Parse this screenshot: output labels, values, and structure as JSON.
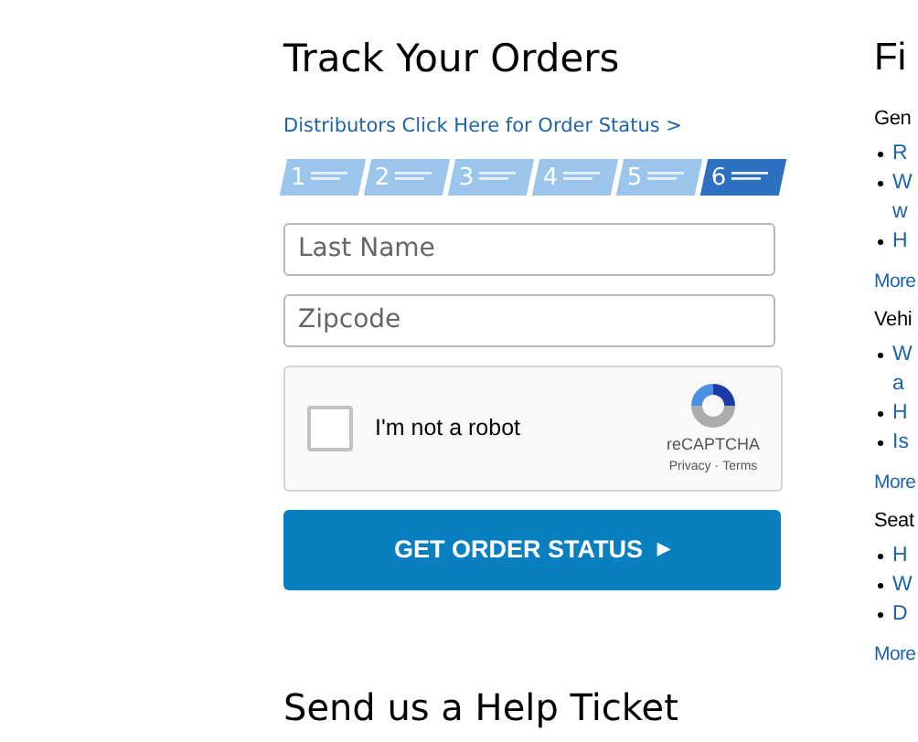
{
  "track": {
    "title": "Track Your Orders",
    "distributor_link": "Distributors Click Here for Order Status >",
    "steps": [
      {
        "number": "1",
        "selected": false
      },
      {
        "number": "2",
        "selected": false
      },
      {
        "number": "3",
        "selected": false
      },
      {
        "number": "4",
        "selected": false
      },
      {
        "number": "5",
        "selected": false
      },
      {
        "number": "6",
        "selected": true
      }
    ],
    "fields": [
      {
        "placeholder": "Last Name"
      },
      {
        "placeholder": "Zipcode"
      }
    ],
    "captcha": {
      "label": "I'm not a robot",
      "checked": false,
      "brand": "reCAPTCHA",
      "privacy": "Privacy",
      "separator": "·",
      "terms": "Terms"
    },
    "button": {
      "label": "GET ORDER STATUS",
      "arrow": "▶"
    }
  },
  "help": {
    "title": "Send us a Help Ticket"
  },
  "faq": {
    "title": "Fi",
    "sections": [
      {
        "heading": "Gen",
        "items": [
          [
            "R"
          ],
          [
            "W",
            "w"
          ],
          [
            "H"
          ]
        ],
        "more": "More"
      },
      {
        "heading": "Vehi",
        "items": [
          [
            "W",
            "a"
          ],
          [
            "H"
          ],
          [
            "Is"
          ]
        ],
        "more": "More"
      },
      {
        "heading": "Seat",
        "items": [
          [
            "H"
          ],
          [
            "W"
          ],
          [
            "D"
          ]
        ],
        "more": "More"
      }
    ]
  }
}
